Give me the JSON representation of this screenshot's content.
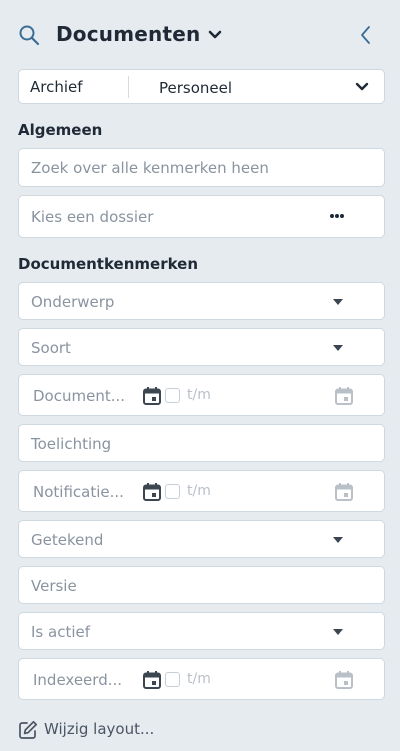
{
  "header": {
    "title": "Documenten",
    "search_icon": "search-icon",
    "dropdown_icon": "chevron-down-icon",
    "back_icon": "chevron-left-icon"
  },
  "archive_selector": {
    "label": "Archief",
    "value": "Personeel"
  },
  "sections": {
    "general": "Algemeen",
    "properties": "Documentkenmerken"
  },
  "general": {
    "search_placeholder": "Zoek over alle kenmerken heen",
    "dossier_placeholder": "Kies een dossier"
  },
  "properties": {
    "subject": "Onderwerp",
    "type": "Soort",
    "document_date": "Document...",
    "explanation": "Toelichting",
    "notification_date": "Notificatie...",
    "signed": "Getekend",
    "version": "Versie",
    "is_active": "Is actief",
    "index_date": "Indexeerd...",
    "range_separator": "t/m"
  },
  "footer": {
    "edit_layout": "Wijzig layout..."
  },
  "colors": {
    "background": "#e6ebf0",
    "accent": "#3a6d96",
    "text": "#1f2a36",
    "placeholder": "#8a94a0"
  }
}
